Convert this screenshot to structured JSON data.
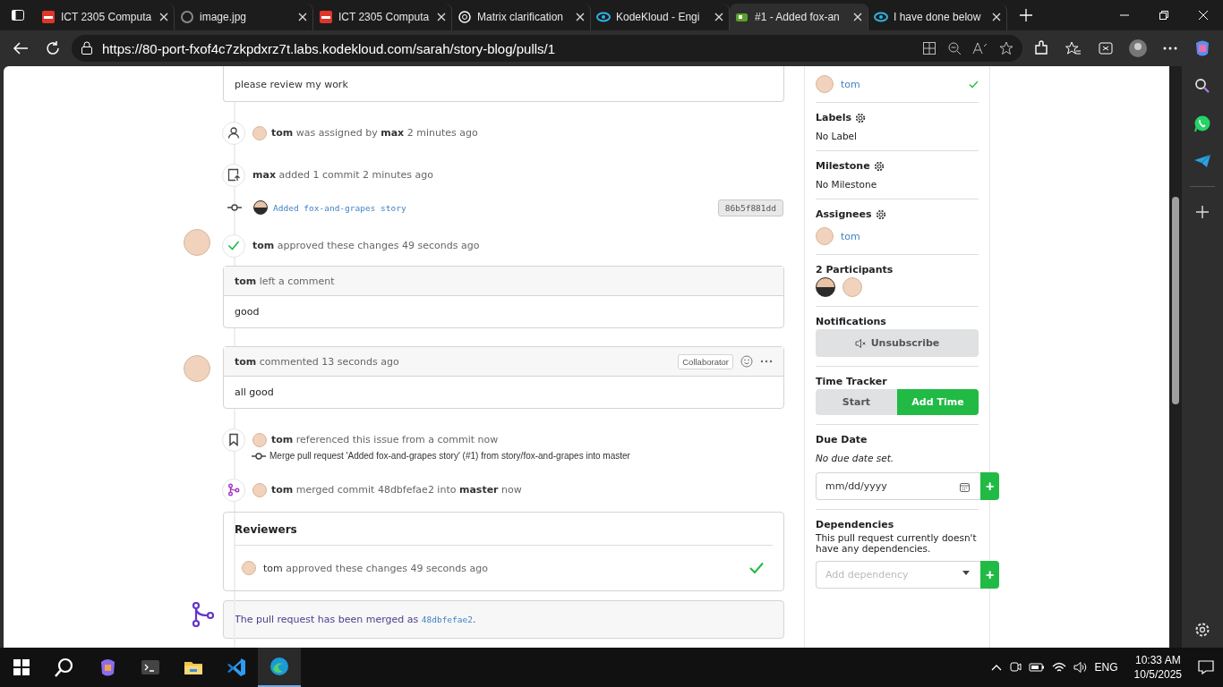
{
  "browser": {
    "tabs": [
      {
        "title": "ICT 2305 Computa",
        "selected": false
      },
      {
        "title": "image.jpg",
        "selected": false
      },
      {
        "title": "ICT 2305 Computa",
        "selected": false
      },
      {
        "title": "Matrix clarification",
        "selected": false
      },
      {
        "title": "KodeKloud - Engi",
        "selected": false
      },
      {
        "title": "#1 - Added fox-an",
        "selected": true
      },
      {
        "title": "I have done below",
        "selected": false
      }
    ],
    "url": "https://80-port-fxof4c7zkpdxrz7t.labs.kodekloud.com/sarah/story-blog/pulls/1"
  },
  "timeline": [
    {
      "kind": "comment_tail",
      "body": "please review my work"
    },
    {
      "kind": "event",
      "text": "**tom** was assigned by **max** 2 minutes ago"
    },
    {
      "kind": "event",
      "text": "**max** added 1 commit 2 minutes ago"
    },
    {
      "kind": "commit",
      "message": "Added fox-and-grapes story",
      "sha": "86b5f881dd"
    },
    {
      "kind": "review",
      "text": "**tom** approved these changes 49 seconds ago",
      "header": "**tom** left a comment",
      "body": "good"
    },
    {
      "kind": "comment",
      "header": "**tom** commented 13 seconds ago",
      "role": "Collaborator",
      "body": "all good"
    },
    {
      "kind": "event",
      "text": "**tom** referenced this issue from a commit now",
      "sub": "Merge pull request 'Added fox-and-grapes story' (#1) from story/fox-and-grapes into master"
    },
    {
      "kind": "event",
      "text": "**tom** merged commit 48dbfefae2 into **master** now"
    },
    {
      "kind": "reviewers",
      "title": "Reviewers",
      "rows": [
        {
          "name": "tom",
          "text": "approved these changes 49 seconds ago",
          "approved": true
        }
      ]
    },
    {
      "kind": "merged",
      "prefix": "The pull request has been merged as",
      "sha": "48dbfefae2",
      "suffix": "."
    }
  ],
  "sidebar": {
    "reviewer": {
      "name": "tom",
      "approved": true
    },
    "labels": {
      "title": "Labels",
      "value": "No Label"
    },
    "milestone": {
      "title": "Milestone",
      "value": "No Milestone"
    },
    "assignees": {
      "title": "Assignees",
      "people": [
        {
          "name": "tom"
        }
      ]
    },
    "participants": {
      "title": "2 Participants"
    },
    "notifications": {
      "title": "Notifications",
      "button": "Unsubscribe"
    },
    "time_tracker": {
      "title": "Time Tracker",
      "buttons": [
        {
          "label": "Start",
          "kind": "secondary"
        },
        {
          "label": "Add Time",
          "kind": "primary"
        }
      ]
    },
    "due_date": {
      "title": "Due Date",
      "note": "No due date set.",
      "placeholder": "mm/dd/yyyy",
      "button": "+"
    },
    "dependencies": {
      "title": "Dependencies",
      "note": "This pull request currently doesn't have any dependencies.",
      "placeholder": "Add dependency",
      "button": "+"
    }
  },
  "taskbar": {
    "apps": [
      {
        "selected": false
      },
      {
        "selected": false
      },
      {
        "selected": false
      },
      {
        "selected": false
      },
      {
        "selected": false
      },
      {
        "selected": true
      }
    ],
    "language": "ENG",
    "time": "10:33 AM",
    "date": "10/5/2025"
  }
}
